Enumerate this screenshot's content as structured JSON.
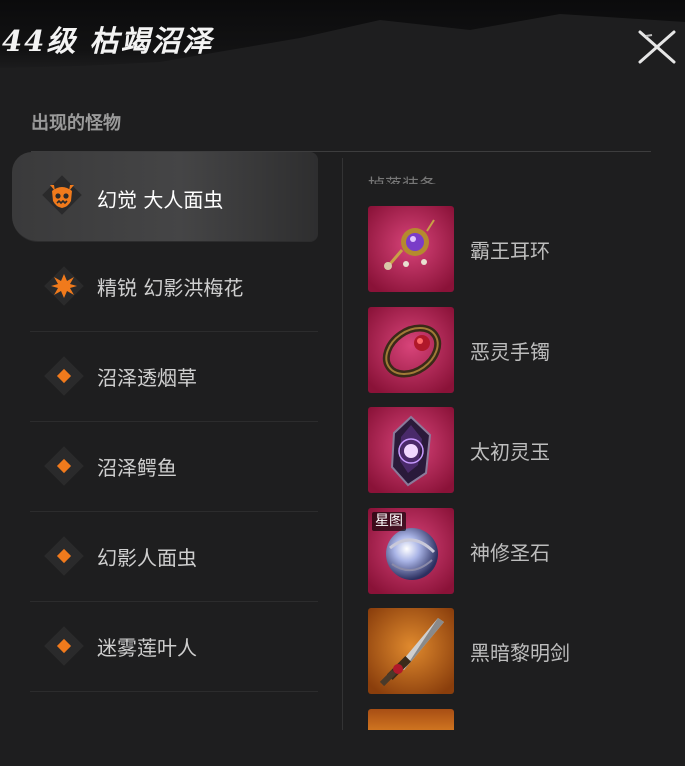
{
  "header": {
    "title": "44级 枯竭沼泽"
  },
  "section": {
    "heading": "出现的怪物"
  },
  "monsters": [
    {
      "label": "幻觉 大人面虫",
      "icon": "demon-skull-icon",
      "active": true
    },
    {
      "label": "精锐 幻影洪梅花",
      "icon": "elite-burst-icon",
      "active": false
    },
    {
      "label": "沼泽透烟草",
      "icon": "diamond-icon",
      "active": false
    },
    {
      "label": "沼泽鳄鱼",
      "icon": "diamond-icon",
      "active": false
    },
    {
      "label": "幻影人面虫",
      "icon": "diamond-icon",
      "active": false
    },
    {
      "label": "迷雾莲叶人",
      "icon": "diamond-icon",
      "active": false
    }
  ],
  "drops": {
    "cutoff_heading": "掉落装备",
    "items": [
      {
        "name": "霸王耳环",
        "icon": "earring-icon",
        "rarity_color": "#b0214d"
      },
      {
        "name": "恶灵手镯",
        "icon": "bracelet-icon",
        "rarity_color": "#b0214d"
      },
      {
        "name": "太初灵玉",
        "icon": "crystal-icon",
        "rarity_color": "#b0214d"
      },
      {
        "name": "神修圣石",
        "icon": "orb-icon",
        "rarity_color": "#b0214d",
        "badge": "星图"
      },
      {
        "name": "黑暗黎明剑",
        "icon": "sword-icon",
        "rarity_color": "#c86a1d"
      }
    ]
  },
  "colors": {
    "accent": "#f07a1c",
    "epic": "#b0214d",
    "legendary": "#c86a1d"
  }
}
